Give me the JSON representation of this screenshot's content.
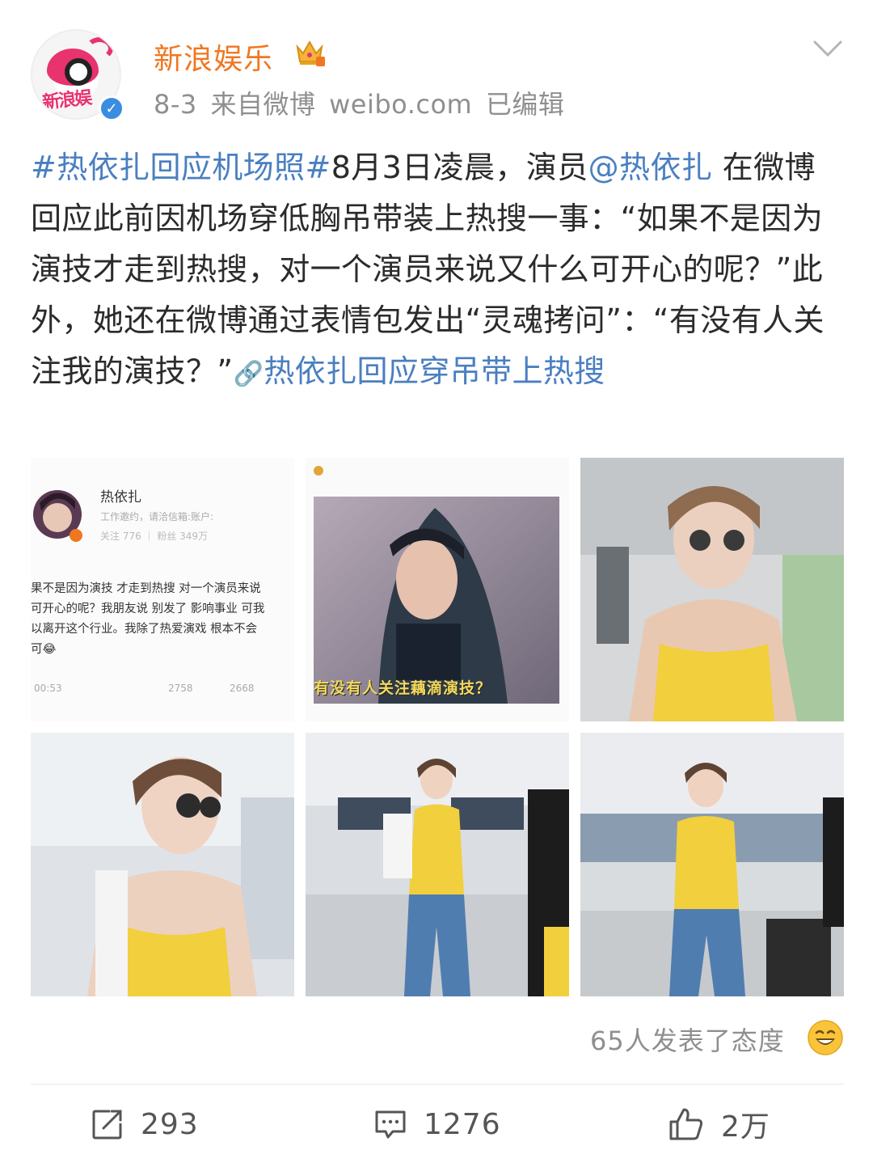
{
  "header": {
    "username": "新浪娱乐",
    "avatar_text": "新浪娱",
    "verify_mark": "✓",
    "meta": "8-3 来自微博 weibo.com 已编辑"
  },
  "post": {
    "hashtag": "#热依扎回应机场照#",
    "text_part1": "8月3日凌晨，演员",
    "mention": "@热依扎",
    "text_part2": " 在微博回应此前因机场穿低胸吊带装上热搜一事：“如果不是因为演技才走到热搜，对一个演员来说又什么可开心的呢？”此外，她还在微博通过表情包发出“灵魂拷问”：“有没有人关注我的演技？”",
    "link_icon": "🔗",
    "link_text": "热依扎回应穿吊带上热搜"
  },
  "images": {
    "screenshot": {
      "name": "热依扎",
      "intro": "工作邀约，请洽信箱:账户:",
      "stats": "关注 776 ｜ 粉丝 349万",
      "lines": [
        "果不是因为演技 才走到热搜 对一个演员来说",
        "可开心的呢？我朋友说 别发了 影响事业 可我",
        "以离开这个行业。我除了热爱演戏 根本不会",
        "可😂"
      ],
      "time": "00:53",
      "reposts": "2758",
      "comments": "2668"
    },
    "meme_caption": "有没有人关注藕滴演技？"
  },
  "reactions": {
    "text": "65人发表了态度"
  },
  "actions": {
    "repost_count": "293",
    "comment_count": "1276",
    "like_count": "2万"
  },
  "colors": {
    "username": "#f07722",
    "link": "#4a7fc1",
    "meta": "#8f8f8f"
  },
  "icons": [
    "crown-icon",
    "chevron-down-icon",
    "verified-icon",
    "link-icon",
    "smile-icon",
    "repost-icon",
    "comment-icon",
    "like-icon"
  ]
}
